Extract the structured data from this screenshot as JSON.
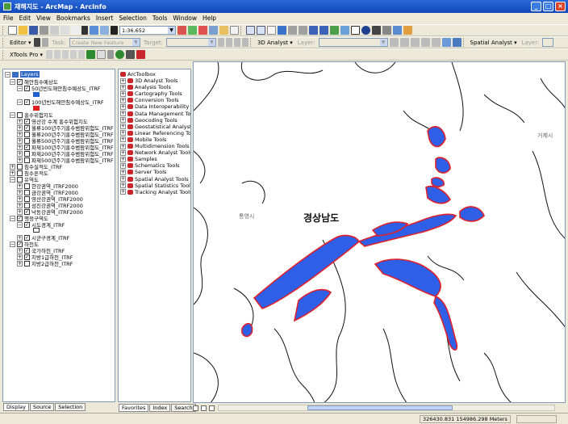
{
  "window": {
    "title": "재해지도 - ArcMap - ArcInfo",
    "controls": [
      "_",
      "□",
      "×"
    ]
  },
  "menu": [
    "File",
    "Edit",
    "View",
    "Bookmarks",
    "Insert",
    "Selection",
    "Tools",
    "Window",
    "Help"
  ],
  "standard_toolbar": {
    "scale": "1:36,652"
  },
  "editor_toolbar": {
    "editor_label": "Editor ▾",
    "task_label": "Task:",
    "task_value": "Create New Feature",
    "target_label": "Target:",
    "analyst3d_label": "3D Analyst ▾",
    "layer_label": "Layer:",
    "spatial_analyst_label": "Spatial Analyst ▾",
    "layer2_label": "Layer:"
  },
  "xtools_toolbar": {
    "label": "XTools Pro ▾"
  },
  "toc": {
    "root": "Layers",
    "groups": [
      {
        "name": "해안침수예상도",
        "expanded": true,
        "checked": true,
        "layers": [
          {
            "name": "50년빈도해안침수예상도_ITRF",
            "checked": true,
            "swatch": "#1f5fd0"
          },
          {
            "name": "100년빈도해안침수예상도_ITRF",
            "checked": true,
            "swatch": "#e02020"
          }
        ]
      },
      {
        "name": "홍수위험지도",
        "expanded": true,
        "checked": false,
        "layers": [
          {
            "name": "영산강 수계 홍수위험지도",
            "checked": true
          },
          {
            "name": "월류100년주기홍수범람위험도_ITRF",
            "checked": true
          },
          {
            "name": "월류200년주기홍수범람위험도_ITRF",
            "checked": false
          },
          {
            "name": "월류500년주기홍수범람위험도_ITRF",
            "checked": false
          },
          {
            "name": "파제100년주기홍수범람위험도_ITRF",
            "checked": true
          },
          {
            "name": "파제200년주기홍수범람위험도_ITRF",
            "checked": false
          },
          {
            "name": "파제500년주기홍수범람위험도_ITRF",
            "checked": false
          }
        ]
      },
      {
        "name": "침수실적도_ITRF",
        "expanded": false,
        "checked": false,
        "layers": []
      },
      {
        "name": "침수흔적도",
        "expanded": false,
        "checked": false,
        "layers": []
      },
      {
        "name": "유역도",
        "expanded": true,
        "checked": false,
        "layers": [
          {
            "name": "한강권역_ITRF2000",
            "checked": false
          },
          {
            "name": "금강권역_ITRF2000",
            "checked": false
          },
          {
            "name": "영산강권역_ITRF2000",
            "checked": false
          },
          {
            "name": "섬진강권역_ITRF2000",
            "checked": false
          },
          {
            "name": "낙동강권역_ITRF2000",
            "checked": true
          }
        ]
      },
      {
        "name": "행정구역도",
        "expanded": true,
        "checked": true,
        "layers": [
          {
            "name": "시도경계_ITRF",
            "checked": true,
            "swatch_outline": true
          },
          {
            "name": "시군구경계_ITRF",
            "checked": true
          }
        ]
      },
      {
        "name": "하천도",
        "expanded": true,
        "checked": true,
        "layers": [
          {
            "name": "국가하천_ITRF",
            "checked": true
          },
          {
            "name": "지방1급하천_ITRF",
            "checked": true
          },
          {
            "name": "지방2급하천_ITRF",
            "checked": false
          }
        ]
      }
    ],
    "tabs": [
      "Display",
      "Source",
      "Selection"
    ]
  },
  "arctoolbox": {
    "root": "ArcToolbox",
    "tools": [
      "3D Analyst Tools",
      "Analysis Tools",
      "Cartography Tools",
      "Conversion Tools",
      "Data Interoperability Tools",
      "Data Management Tools",
      "Geocoding Tools",
      "Geostatistical Analyst Tools",
      "Linear Referencing Tools",
      "Mobile Tools",
      "Multidimension Tools",
      "Network Analyst Tools",
      "Samples",
      "Schematics Tools",
      "Server Tools",
      "Spatial Analyst Tools",
      "Spatial Statistics Tools",
      "Tracking Analyst Tools"
    ],
    "tabs": [
      "Favorites",
      "Index",
      "Search"
    ]
  },
  "map": {
    "labels": {
      "tongyeong": "통영시",
      "gyeongnam": "경상남도",
      "geoje": "거제시"
    },
    "flood_fill": "#2f5fe6",
    "flood_edge": "#e0202a"
  },
  "status": {
    "coordinates": "326430.831  154986.298 Meters"
  }
}
